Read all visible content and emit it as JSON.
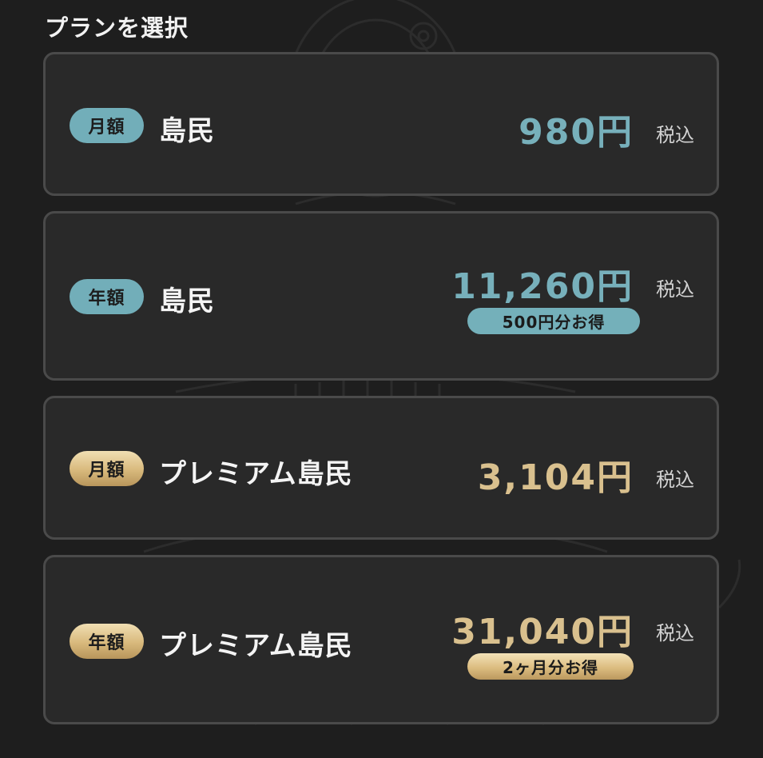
{
  "page": {
    "title": "プランを選択"
  },
  "plans": [
    {
      "period": "月額",
      "name": "島民",
      "price": "980円",
      "tax": "税込",
      "badge": null,
      "tier": "standard"
    },
    {
      "period": "年額",
      "name": "島民",
      "price": "11,260円",
      "tax": "税込",
      "badge": "500円分お得",
      "tier": "standard"
    },
    {
      "period": "月額",
      "name": "プレミアム島民",
      "price": "3,104円",
      "tax": "税込",
      "badge": null,
      "tier": "premium"
    },
    {
      "period": "年額",
      "name": "プレミアム島民",
      "price": "31,040円",
      "tax": "税込",
      "badge": "2ヶ月分お得",
      "tier": "premium"
    }
  ],
  "colors": {
    "background": "#1e1e1e",
    "card": "#292929",
    "card_border": "#4a4a4a",
    "standard_accent": "#72aeb9",
    "premium_accent": "#d9c08e"
  }
}
